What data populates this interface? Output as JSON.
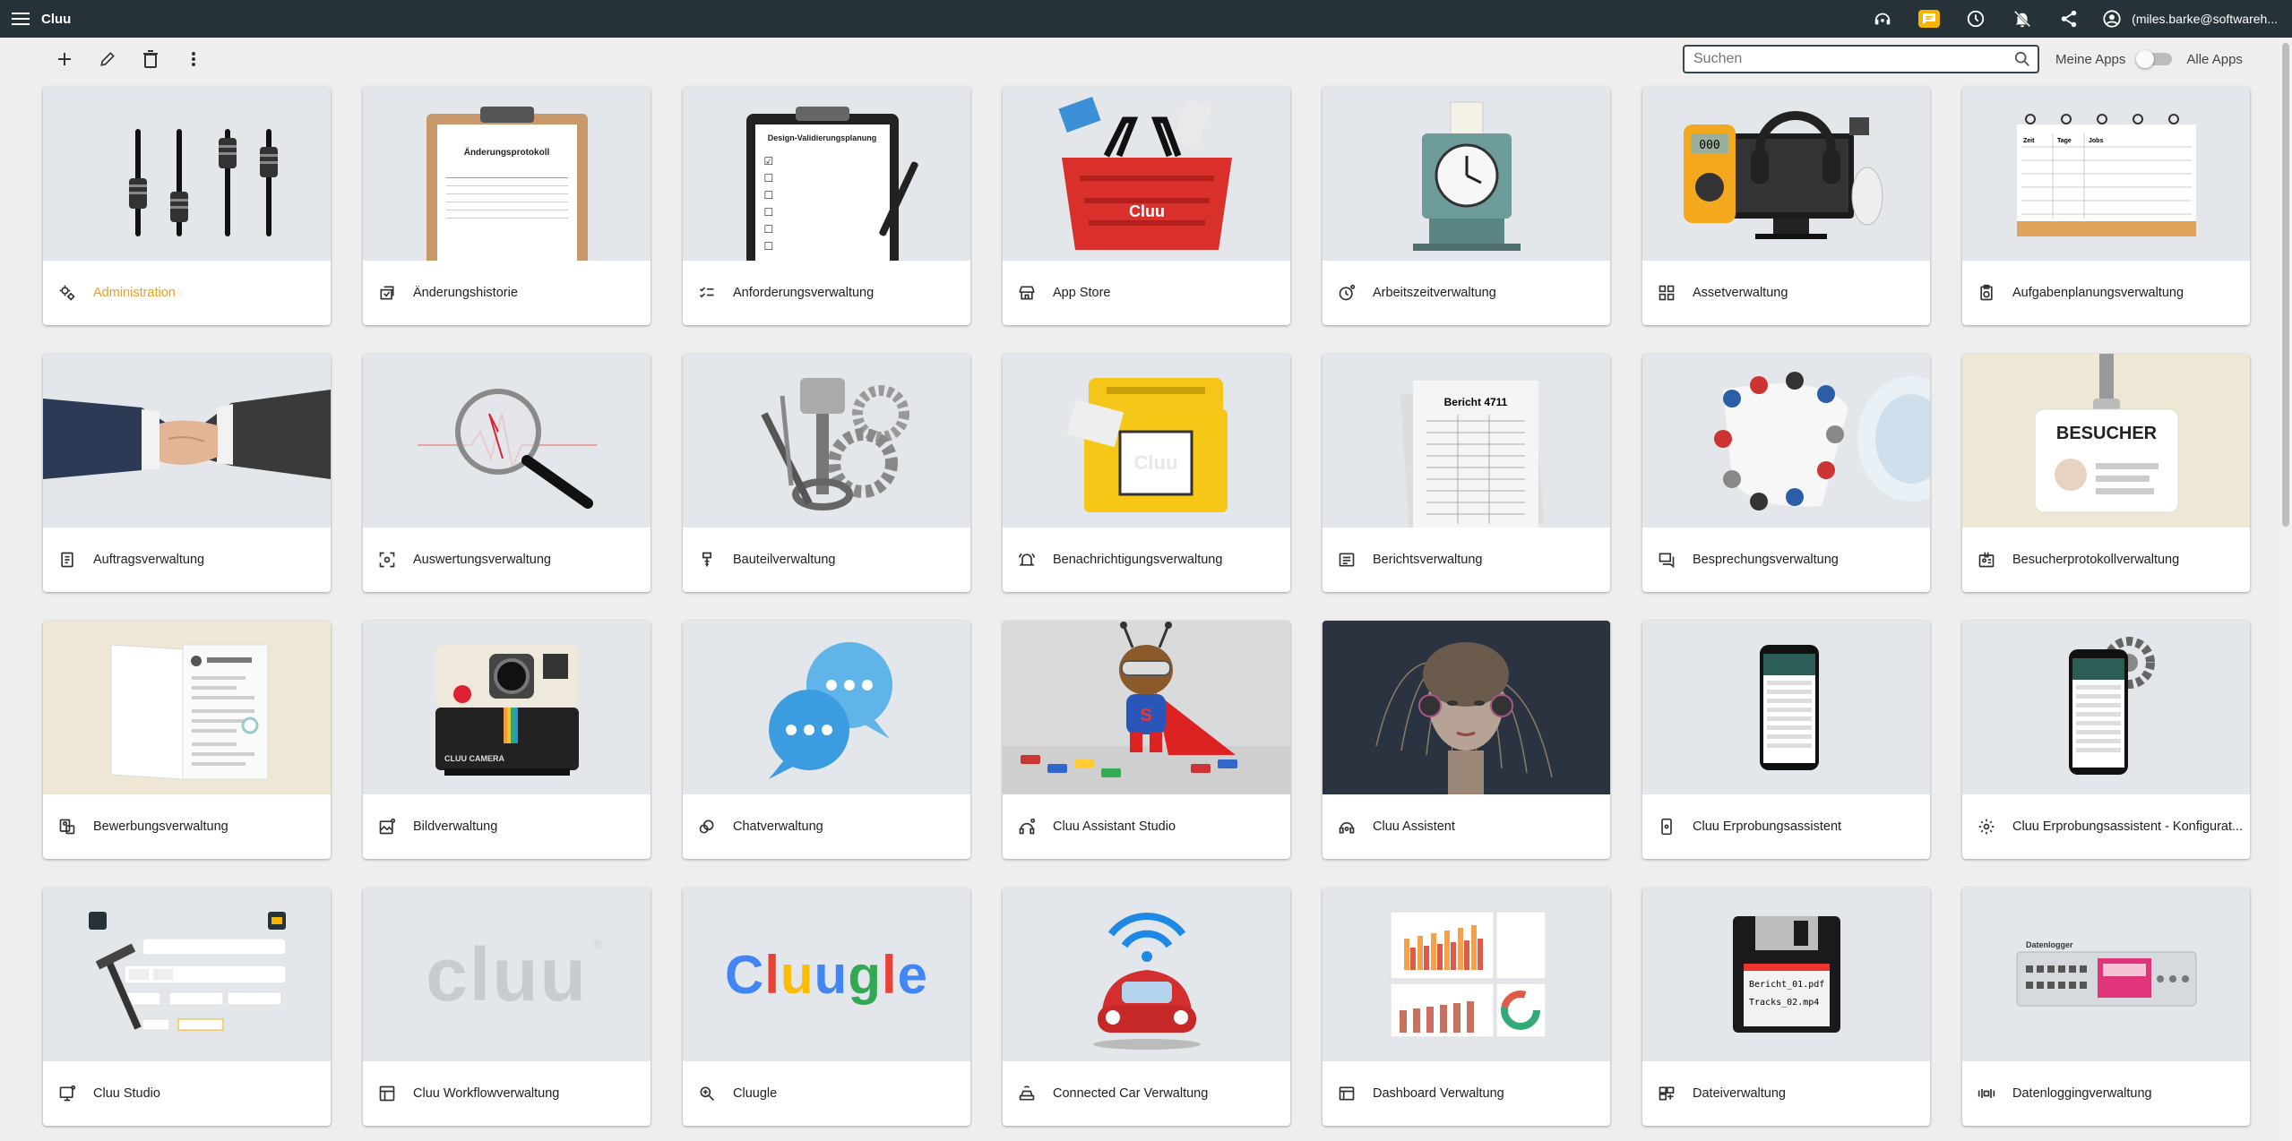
{
  "appbar": {
    "title": "Cluu",
    "user": "(miles.barke@softwareh..."
  },
  "search": {
    "placeholder": "Suchen",
    "value": ""
  },
  "filter": {
    "left_label": "Meine Apps",
    "right_label": "Alle Apps",
    "state": "off"
  },
  "colors": {
    "appbar": "#263238",
    "accent": "#f29d1b",
    "notification": "#f4b400"
  },
  "apps": [
    {
      "label": "Administration",
      "icon": "admin-settings-icon",
      "active": true,
      "image": "mixer-faders"
    },
    {
      "label": "Änderungshistorie",
      "icon": "history-icon",
      "image": "clipboard-protocol",
      "image_text": "Änderungsprotokoll"
    },
    {
      "label": "Anforderungsverwaltung",
      "icon": "checklist-icon",
      "image": "clipboard-checklist",
      "image_text": "Design-Validierungsplanung"
    },
    {
      "label": "App Store",
      "icon": "store-icon",
      "image": "shopping-basket",
      "image_text": "Cluu"
    },
    {
      "label": "Arbeitszeitverwaltung",
      "icon": "clock-icon",
      "image": "time-clock"
    },
    {
      "label": "Assetverwaltung",
      "icon": "grid-icon",
      "image": "devices"
    },
    {
      "label": "Aufgabenplanungsverwaltung",
      "icon": "clipboard-clock-icon",
      "image": "calendar-table"
    },
    {
      "label": "Auftragsverwaltung",
      "icon": "document-icon",
      "image": "handshake"
    },
    {
      "label": "Auswertungsverwaltung",
      "icon": "analytics-icon",
      "image": "magnifier"
    },
    {
      "label": "Bauteilverwaltung",
      "icon": "component-icon",
      "image": "engine-parts"
    },
    {
      "label": "Benachrichtigungsverwaltung",
      "icon": "bell-ring-icon",
      "image": "mailbox",
      "image_text": "Cluu"
    },
    {
      "label": "Berichtsverwaltung",
      "icon": "report-icon",
      "image": "report-paper",
      "image_text": "Bericht 4711"
    },
    {
      "label": "Besprechungsverwaltung",
      "icon": "chat-icon",
      "image": "meeting-table"
    },
    {
      "label": "Besucherprotokollverwaltung",
      "icon": "visitor-icon",
      "image": "visitor-badge",
      "image_text": "BESUCHER"
    },
    {
      "label": "Bewerbungsverwaltung",
      "icon": "application-icon",
      "image": "resume-folder"
    },
    {
      "label": "Bildverwaltung",
      "icon": "image-icon",
      "image": "instant-camera",
      "image_text": "CLUU CAMERA"
    },
    {
      "label": "Chatverwaltung",
      "icon": "chat-bubbles-icon",
      "image": "speech-bubbles"
    },
    {
      "label": "Cluu Assistant Studio",
      "icon": "assistant-studio-icon",
      "image": "superhero-toy"
    },
    {
      "label": "Cluu Assistent",
      "icon": "headset-icon",
      "image": "cyborg"
    },
    {
      "label": "Cluu Erprobungsassistent",
      "icon": "phone-icon",
      "image": "smartphone"
    },
    {
      "label": "Cluu Erprobungsassistent - Konfigurat...",
      "icon": "gear-icon",
      "image": "smartphone-gear"
    },
    {
      "label": "Cluu Studio",
      "icon": "studio-icon",
      "image": "ui-builder"
    },
    {
      "label": "Cluu Workflowverwaltung",
      "icon": "workflow-icon",
      "image": "cluu-logo",
      "image_text": "cluu"
    },
    {
      "label": "Cluugle",
      "icon": "search-zoom-icon",
      "image": "cluugle-logo",
      "image_text": "Cluugle"
    },
    {
      "label": "Connected Car Verwaltung",
      "icon": "car-icon",
      "image": "connected-car"
    },
    {
      "label": "Dashboard Verwaltung",
      "icon": "dashboard-icon",
      "image": "dashboard-charts"
    },
    {
      "label": "Dateiverwaltung",
      "icon": "file-manager-icon",
      "image": "floppy-disk",
      "image_text": "Bericht_01.pdf|Tracks_02.mp4"
    },
    {
      "label": "Datenloggingverwaltung",
      "icon": "datalogger-icon",
      "image": "data-logger",
      "image_text": "Datenlogger"
    }
  ]
}
